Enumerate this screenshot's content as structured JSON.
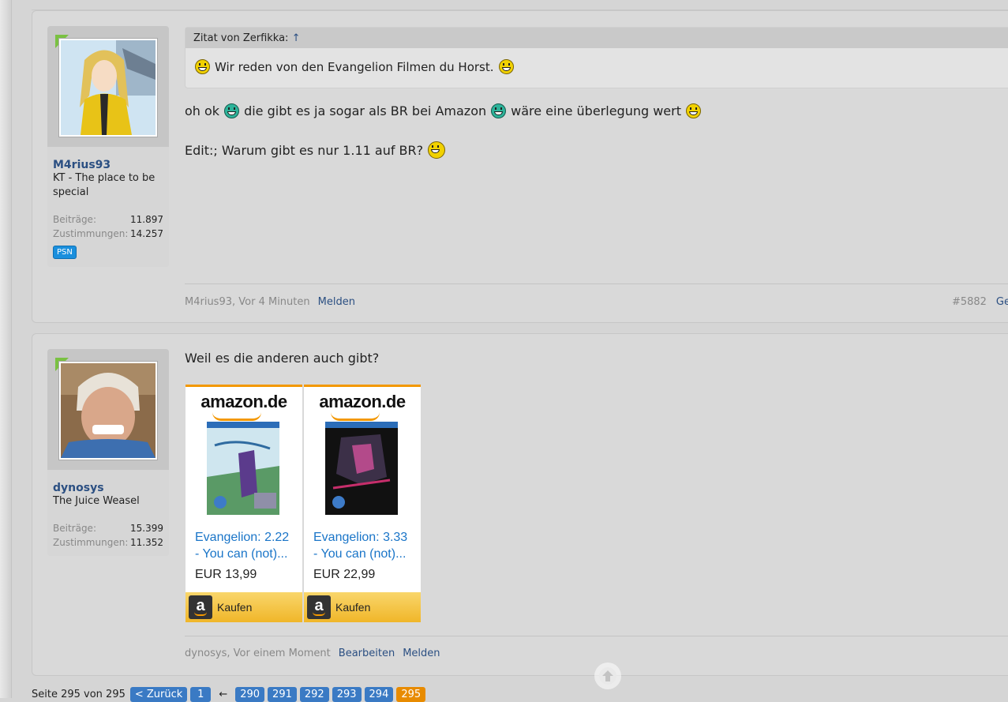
{
  "posts": [
    {
      "user": {
        "name": "M4rius93",
        "title": "KT - The place to be special",
        "stats": [
          {
            "label": "Beiträge:",
            "value": "11.897"
          },
          {
            "label": "Zustimmungen:",
            "value": "14.257"
          }
        ],
        "badge": "PSN"
      },
      "quote": {
        "header": "Zitat von Zerfikka:",
        "arrow": "↑",
        "text": "Wir reden von den Evangelion Filmen du Horst."
      },
      "lines": [
        {
          "a": "oh ok",
          "b": "die gibt es ja sogar als BR bei Amazon",
          "c": "wäre eine überlegung wert"
        },
        {
          "a": "Edit:; Warum gibt es nur 1.11 auf BR?"
        }
      ],
      "footer": {
        "meta": "M4rius93, Vor 4 Minuten",
        "report": "Melden",
        "number": "#5882",
        "extra": "Ge"
      }
    },
    {
      "user": {
        "name": "dynosys",
        "title": "The Juice Weasel",
        "stats": [
          {
            "label": "Beiträge:",
            "value": "15.399"
          },
          {
            "label": "Zustimmungen:",
            "value": "11.352"
          }
        ]
      },
      "text": "Weil es die anderen auch gibt?",
      "products": [
        {
          "logo": "amazon.de",
          "title1": "Evangelion: 2.22",
          "title2": "- You can (not)...",
          "price": "EUR 13,99",
          "buy": "Kaufen",
          "buy_icon": "a"
        },
        {
          "logo": "amazon.de",
          "title1": "Evangelion: 3.33",
          "title2": "- You can (not)...",
          "price": "EUR 22,99",
          "buy": "Kaufen",
          "buy_icon": "a"
        }
      ],
      "footer": {
        "meta": "dynosys, Vor einem Moment",
        "edit": "Bearbeiten",
        "report": "Melden"
      }
    }
  ],
  "pagination": {
    "label": "Seite 295 von 295",
    "back": "< Zurück",
    "first": "1",
    "ellipsis": "←",
    "pages": [
      "290",
      "291",
      "292",
      "293",
      "294",
      "295"
    ],
    "current": "295"
  },
  "colors": {
    "link": "#2b4f82",
    "accent_green": "#7ac142",
    "amazon_orange": "#f39800",
    "page_button": "#3a7ac4",
    "page_current": "#e88b00"
  },
  "icons": {
    "scroll_top": "arrow-up-circle-icon"
  }
}
